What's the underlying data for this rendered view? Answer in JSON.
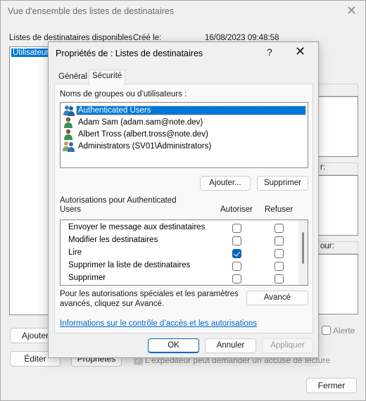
{
  "background_window": {
    "title": "Vue d'ensemble des listes de destinataires",
    "lists_label": "Listes de destinataires disponibles",
    "created_label": "Créé le:",
    "created_value": "16/08/2023 09:48:58",
    "lists": [
      "Utilisateurs"
    ],
    "group_heads": [
      "",
      "r:",
      "our:"
    ],
    "alert_label": "Alerte",
    "read_receipt_label": "L'expéditeur peut demander un accusé de lecture",
    "buttons": {
      "add": "Ajouter",
      "edit": "Éditer",
      "properties": "Propriétés",
      "close": "Fermer"
    }
  },
  "dialog": {
    "title": "Propriétés de : Listes de destinataires",
    "help": "?",
    "tabs": [
      {
        "label": "Général",
        "active": false
      },
      {
        "label": "Sécurité",
        "active": true
      }
    ],
    "groups_label": "Noms de groupes ou d’utilisateurs :",
    "users": [
      {
        "name": "Authenticated Users",
        "icon": "group-icon",
        "selected": true
      },
      {
        "name": "Adam Sam (adam.sam@note.dev)",
        "icon": "user-icon",
        "selected": false
      },
      {
        "name": "Albert Tross (albert.tross@note.dev)",
        "icon": "user-icon",
        "selected": false
      },
      {
        "name": "Administrators (SV01\\Administrators)",
        "icon": "admin-group-icon",
        "selected": false
      }
    ],
    "add_button": "Ajouter...",
    "remove_button": "Supprimer",
    "permissions_label_line1": "Autorisations pour Authenticated",
    "permissions_label_line2": "Users",
    "allow_header": "Autoriser",
    "deny_header": "Refuser",
    "permissions": [
      {
        "name": "Envoyer le message aux destinataires",
        "allow": false,
        "deny": false
      },
      {
        "name": "Modifier les destinataires",
        "allow": false,
        "deny": false
      },
      {
        "name": "Lire",
        "allow": true,
        "deny": false
      },
      {
        "name": "Supprimer la liste de destinataires",
        "allow": false,
        "deny": false
      },
      {
        "name": "Supprimer",
        "allow": false,
        "deny": false
      }
    ],
    "advanced_text_line1": "Pour les autorisations spéciales et les paramètres",
    "advanced_text_line2": "avancés, cliquez sur Avancé.",
    "advanced_button": "Avancé",
    "info_link": "Informations sur le contrôle d’accès et les autorisations",
    "ok_button": "OK",
    "cancel_button": "Annuler",
    "apply_button": "Appliquer"
  },
  "colors": {
    "accent": "#0067c0",
    "selection": "#0078d7",
    "link": "#0066cc"
  }
}
